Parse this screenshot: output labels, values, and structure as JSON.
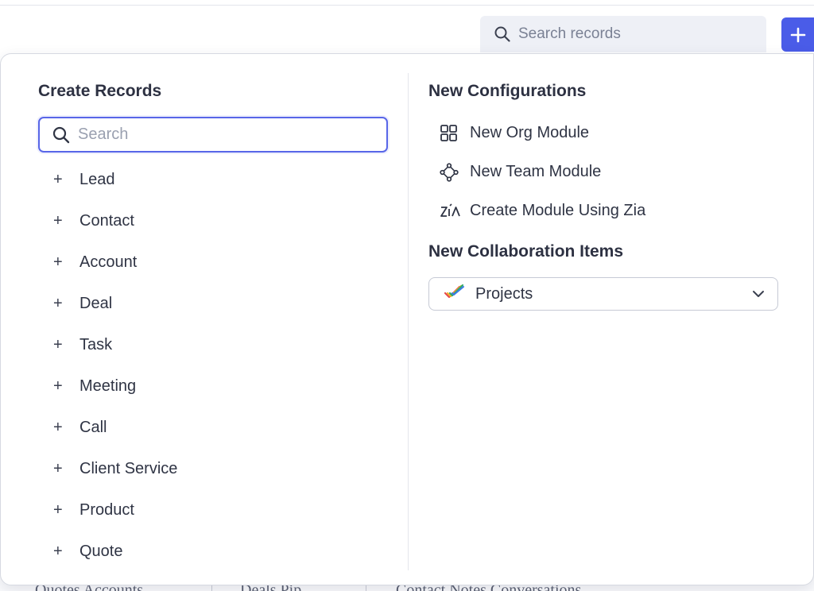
{
  "header": {
    "search_placeholder": "Search records",
    "add_button_label": "+"
  },
  "background": {
    "words": [
      "Quotes Accounts",
      "Deals Pip",
      "Contact Notes Conversations"
    ]
  },
  "create_records": {
    "title": "Create Records",
    "search_placeholder": "Search",
    "items": [
      {
        "label": "Lead"
      },
      {
        "label": "Contact"
      },
      {
        "label": "Account"
      },
      {
        "label": "Deal"
      },
      {
        "label": "Task"
      },
      {
        "label": "Meeting"
      },
      {
        "label": "Call"
      },
      {
        "label": "Client Service"
      },
      {
        "label": "Product"
      },
      {
        "label": "Quote"
      }
    ],
    "item_prefix": "+"
  },
  "new_configurations": {
    "title": "New Configurations",
    "items": [
      {
        "label": "New Org Module",
        "icon": "org-module-icon"
      },
      {
        "label": "New Team Module",
        "icon": "team-module-icon"
      },
      {
        "label": "Create Module Using Zia",
        "icon": "zia-icon"
      }
    ]
  },
  "collaboration": {
    "title": "New Collaboration Items",
    "select_value": "Projects",
    "select_icon": "projects-icon"
  },
  "colors": {
    "accent": "#4a5ce8",
    "text": "#2f3444",
    "border": "#d6d9e1"
  }
}
